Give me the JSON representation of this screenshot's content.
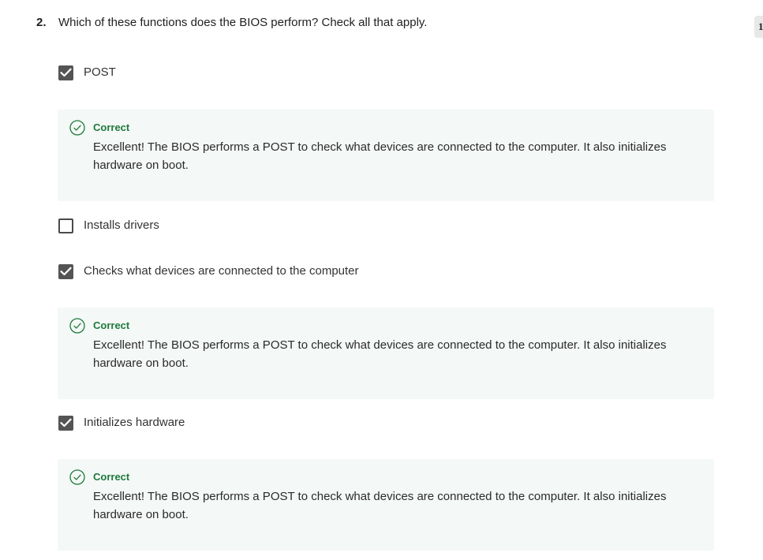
{
  "question": {
    "number": "2.",
    "text": "Which of these functions does the BIOS perform? Check all that apply.",
    "grade_chip": "1"
  },
  "options": [
    {
      "label": "POST",
      "checked": true,
      "feedback": {
        "title": "Correct",
        "text": "Excellent! The BIOS performs a POST to check what devices are connected to the computer. It also initializes hardware on boot."
      }
    },
    {
      "label": "Installs drivers",
      "checked": false
    },
    {
      "label": "Checks what devices are connected to the computer",
      "checked": true,
      "feedback": {
        "title": "Correct",
        "text": "Excellent! The BIOS performs a POST to check what devices are connected to the computer. It also initializes hardware on boot."
      }
    },
    {
      "label": "Initializes hardware",
      "checked": true,
      "feedback": {
        "title": "Correct",
        "text": "Excellent! The BIOS performs a POST to check what devices are connected to the computer. It also initializes hardware on boot."
      }
    }
  ],
  "icons": {
    "checked": "checkmark-icon",
    "correct": "check-circle-icon"
  },
  "colors": {
    "correct_green": "#1e7a3c",
    "feedback_bg": "#f4f8f6",
    "checkbox_fill": "#545454"
  }
}
